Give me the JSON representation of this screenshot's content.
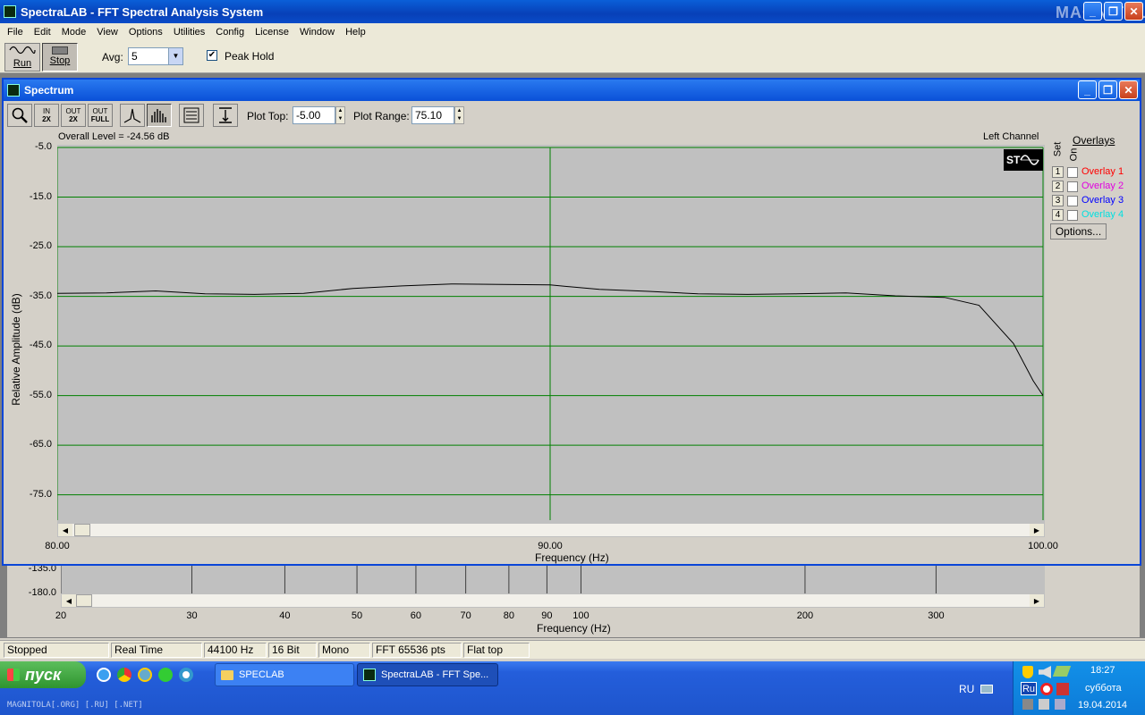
{
  "window": {
    "title": "SpectraLAB - FFT Spectral Analysis System"
  },
  "watermark": "MAGNITOLA",
  "menu": [
    "File",
    "Edit",
    "Mode",
    "View",
    "Options",
    "Utilities",
    "Config",
    "License",
    "Window",
    "Help"
  ],
  "toolbar": {
    "run_label": "Run",
    "stop_label": "Stop",
    "avg_label": "Avg:",
    "avg_value": "5",
    "peak_hold_label": "Peak Hold",
    "peak_hold_checked": true
  },
  "spectrum": {
    "title": "Spectrum",
    "tools": {
      "zoom_in_label": "IN",
      "zoom_in_factor": "2X",
      "zoom_out_label": "OUT",
      "zoom_out_factor": "2X",
      "zoom_full_label": "OUT",
      "zoom_full_factor": "FULL"
    },
    "plot_top_label": "Plot Top:",
    "plot_top_value": "-5.00",
    "plot_range_label": "Plot Range:",
    "plot_range_value": "75.10",
    "overall_level": "Overall Level = -24.56 dB",
    "channel": "Left Channel",
    "logo_text": "ST",
    "overlays": {
      "title": "Overlays",
      "set_label": "Set",
      "on_label": "On",
      "items": [
        {
          "num": "1",
          "label": "Overlay 1",
          "color": "#ff0000"
        },
        {
          "num": "2",
          "label": "Overlay 2",
          "color": "#e000e0"
        },
        {
          "num": "3",
          "label": "Overlay 3",
          "color": "#0000ff"
        },
        {
          "num": "4",
          "label": "Overlay 4",
          "color": "#00e0e0"
        }
      ],
      "options_label": "Options..."
    }
  },
  "chart_data": [
    {
      "type": "line",
      "title": "",
      "xlabel": "Frequency (Hz)",
      "ylabel": "Relative Amplitude (dB)",
      "xlim": [
        80,
        100
      ],
      "ylim": [
        -80.1,
        -5.0
      ],
      "x_ticks": [
        "80.00",
        "90.00",
        "100.00"
      ],
      "x_tick_values": [
        80,
        90,
        100
      ],
      "y_ticks": [
        "-5.0",
        "-15.0",
        "-25.0",
        "-35.0",
        "-45.0",
        "-55.0",
        "-65.0",
        "-75.0"
      ],
      "y_tick_values": [
        -5,
        -15,
        -25,
        -35,
        -45,
        -55,
        -65,
        -75
      ],
      "grid": true,
      "series": [
        {
          "x": [
            80,
            81,
            82,
            83,
            84,
            85,
            86,
            87,
            88,
            89,
            90,
            91,
            92,
            93,
            94,
            95,
            96,
            97,
            98,
            98.7,
            99.4,
            99.8,
            100
          ],
          "y": [
            -34.4,
            -34.3,
            -33.9,
            -34.5,
            -34.6,
            -34.4,
            -33.4,
            -32.9,
            -32.5,
            -32.6,
            -32.7,
            -33.6,
            -34.0,
            -34.5,
            -34.6,
            -34.5,
            -34.3,
            -34.9,
            -35.2,
            -36.8,
            -44.5,
            -52.0,
            -55.0
          ]
        }
      ]
    },
    {
      "type": "line",
      "xlabel": "Frequency (Hz)",
      "x_ticks": [
        "20",
        "30",
        "40",
        "50",
        "60",
        "70",
        "80",
        "90",
        "100",
        "200",
        "300"
      ],
      "x_tick_values": [
        20,
        30,
        40,
        50,
        60,
        70,
        80,
        90,
        100,
        200,
        300
      ],
      "xscale": "log",
      "y_ticks": [
        "-135.0",
        "-180.0"
      ],
      "y_tick_values": [
        -135,
        -180
      ]
    }
  ],
  "status": [
    "Stopped",
    "Real Time",
    "44100 Hz",
    "16 Bit",
    "Mono",
    "FFT 65536 pts",
    "Flat top"
  ],
  "taskbar": {
    "start_label": "пуск",
    "tasks": [
      {
        "label": "SPECLAB"
      },
      {
        "label": "SpectraLAB - FFT Spe..."
      }
    ],
    "lang": "RU",
    "tray_lang": "Ru",
    "time": "18:27",
    "day": "суббота",
    "date": "19.04.2014",
    "footer": "MAGNITOLA[.ORG] [.RU] [.NET]"
  }
}
